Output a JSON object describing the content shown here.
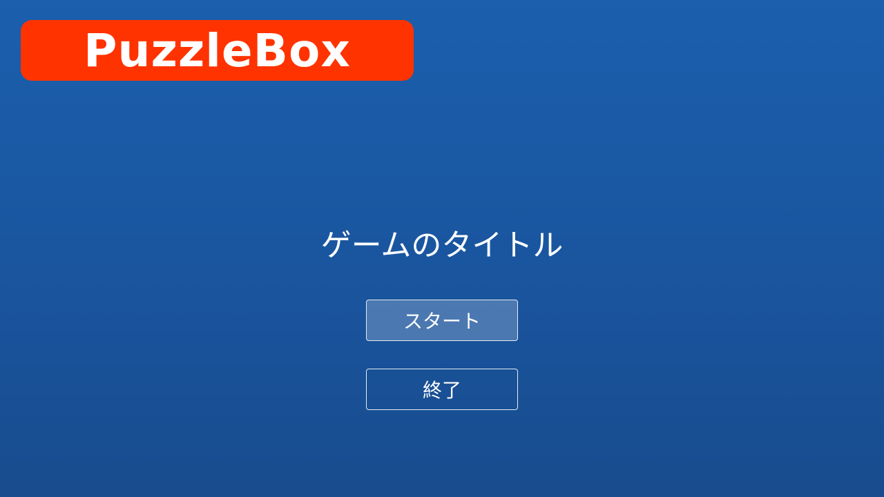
{
  "brand": {
    "logo_text": "PuzzleBox",
    "badge_color": "#ff3300"
  },
  "title_screen": {
    "title": "ゲームのタイトル",
    "start_label": "スタート",
    "quit_label": "終了",
    "focused_button": "start"
  },
  "colors": {
    "background": "#1a56a0",
    "text": "#ffffff"
  }
}
